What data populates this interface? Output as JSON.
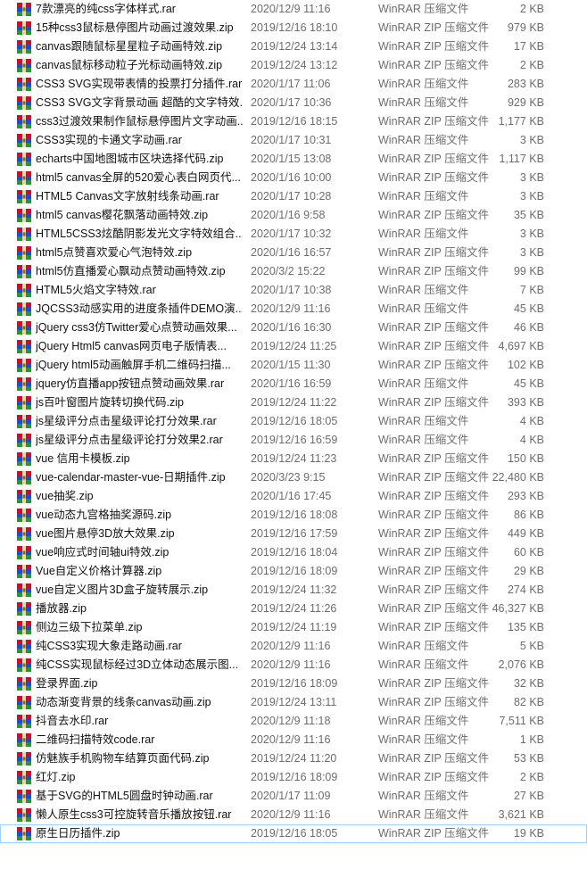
{
  "files": [
    {
      "name": "7款漂亮的纯css字体样式.rar",
      "date": "2020/12/9 11:16",
      "type": "WinRAR 压缩文件",
      "size": "2 KB"
    },
    {
      "name": "15种css3鼠标悬停图片动画过渡效果.zip",
      "date": "2019/12/16 18:10",
      "type": "WinRAR ZIP 压缩文件",
      "size": "979 KB"
    },
    {
      "name": "canvas跟随鼠标星星粒子动画特效.zip",
      "date": "2019/12/24 13:14",
      "type": "WinRAR ZIP 压缩文件",
      "size": "17 KB"
    },
    {
      "name": "canvas鼠标移动粒子光标动画特效.zip",
      "date": "2019/12/24 13:12",
      "type": "WinRAR ZIP 压缩文件",
      "size": "2 KB"
    },
    {
      "name": "CSS3 SVG实现带表情的投票打分插件.rar",
      "date": "2020/1/17 11:06",
      "type": "WinRAR 压缩文件",
      "size": "283 KB"
    },
    {
      "name": "CSS3 SVG文字背景动画 超酷的文字特效...",
      "date": "2020/1/17 10:36",
      "type": "WinRAR 压缩文件",
      "size": "929 KB"
    },
    {
      "name": "css3过渡效果制作鼠标悬停图片文字动画...",
      "date": "2019/12/16 18:15",
      "type": "WinRAR ZIP 压缩文件",
      "size": "1,177 KB"
    },
    {
      "name": "CSS3实现的卡通文字动画.rar",
      "date": "2020/1/17 10:31",
      "type": "WinRAR 压缩文件",
      "size": "3 KB"
    },
    {
      "name": "echarts中国地图城市区块选择代码.zip",
      "date": "2020/1/15 13:08",
      "type": "WinRAR ZIP 压缩文件",
      "size": "1,117 KB"
    },
    {
      "name": "html5 canvas全屏的520爱心表白网页代...",
      "date": "2020/1/16 10:00",
      "type": "WinRAR ZIP 压缩文件",
      "size": "3 KB"
    },
    {
      "name": "HTML5 Canvas文字放射线条动画.rar",
      "date": "2020/1/17 10:28",
      "type": "WinRAR 压缩文件",
      "size": "3 KB"
    },
    {
      "name": "html5 canvas樱花飘落动画特效.zip",
      "date": "2020/1/16 9:58",
      "type": "WinRAR ZIP 压缩文件",
      "size": "35 KB"
    },
    {
      "name": "HTML5CSS3炫酷阴影发光文字特效组合...",
      "date": "2020/1/17 10:32",
      "type": "WinRAR 压缩文件",
      "size": "3 KB"
    },
    {
      "name": "html5点赞喜欢爱心气泡特效.zip",
      "date": "2020/1/16 16:57",
      "type": "WinRAR ZIP 压缩文件",
      "size": "3 KB"
    },
    {
      "name": "html5仿直播爱心飘动点赞动画特效.zip",
      "date": "2020/3/2 15:22",
      "type": "WinRAR ZIP 压缩文件",
      "size": "99 KB"
    },
    {
      "name": "HTML5火焰文字特效.rar",
      "date": "2020/1/17 10:38",
      "type": "WinRAR 压缩文件",
      "size": "7 KB"
    },
    {
      "name": "JQCSS3动感实用的进度条插件DEMO演...",
      "date": "2020/12/9 11:16",
      "type": "WinRAR 压缩文件",
      "size": "45 KB"
    },
    {
      "name": "jQuery css3仿Twitter爱心点赞动画效果...",
      "date": "2020/1/16 16:30",
      "type": "WinRAR ZIP 压缩文件",
      "size": "46 KB"
    },
    {
      "name": "jQuery Html5 canvas网页电子版情表...",
      "date": "2019/12/24 11:25",
      "type": "WinRAR ZIP 压缩文件",
      "size": "4,697 KB"
    },
    {
      "name": "jQuery html5动画触屏手机二维码扫描...",
      "date": "2020/1/15 11:30",
      "type": "WinRAR ZIP 压缩文件",
      "size": "102 KB"
    },
    {
      "name": "jquery仿直播app按钮点赞动画效果.rar",
      "date": "2020/1/16 16:59",
      "type": "WinRAR 压缩文件",
      "size": "45 KB"
    },
    {
      "name": "js百叶窗图片旋转切换代码.zip",
      "date": "2019/12/24 11:22",
      "type": "WinRAR ZIP 压缩文件",
      "size": "393 KB"
    },
    {
      "name": "js星级评分点击星级评论打分效果.rar",
      "date": "2019/12/16 18:05",
      "type": "WinRAR 压缩文件",
      "size": "4 KB"
    },
    {
      "name": "js星级评分点击星级评论打分效果2.rar",
      "date": "2019/12/16 16:59",
      "type": "WinRAR 压缩文件",
      "size": "4 KB"
    },
    {
      "name": "vue 信用卡模板.zip",
      "date": "2019/12/24 11:23",
      "type": "WinRAR ZIP 压缩文件",
      "size": "150 KB"
    },
    {
      "name": "vue-calendar-master-vue-日期插件.zip",
      "date": "2020/3/23 9:15",
      "type": "WinRAR ZIP 压缩文件",
      "size": "22,480 KB"
    },
    {
      "name": "vue抽奖.zip",
      "date": "2020/1/16 17:45",
      "type": "WinRAR ZIP 压缩文件",
      "size": "293 KB"
    },
    {
      "name": "vue动态九宫格抽奖源码.zip",
      "date": "2019/12/16 18:08",
      "type": "WinRAR ZIP 压缩文件",
      "size": "86 KB"
    },
    {
      "name": "vue图片悬停3D放大效果.zip",
      "date": "2019/12/16 17:59",
      "type": "WinRAR ZIP 压缩文件",
      "size": "449 KB"
    },
    {
      "name": "vue响应式时间轴ui特效.zip",
      "date": "2019/12/16 18:04",
      "type": "WinRAR ZIP 压缩文件",
      "size": "60 KB"
    },
    {
      "name": "Vue自定义价格计算器.zip",
      "date": "2019/12/16 18:09",
      "type": "WinRAR ZIP 压缩文件",
      "size": "29 KB"
    },
    {
      "name": "vue自定义图片3D盒子旋转展示.zip",
      "date": "2019/12/24 11:32",
      "type": "WinRAR ZIP 压缩文件",
      "size": "274 KB"
    },
    {
      "name": "播放器.zip",
      "date": "2019/12/24 11:26",
      "type": "WinRAR ZIP 压缩文件",
      "size": "46,327 KB"
    },
    {
      "name": "侧边三级下拉菜单.zip",
      "date": "2019/12/24 11:19",
      "type": "WinRAR ZIP 压缩文件",
      "size": "135 KB"
    },
    {
      "name": "纯CSS3实现大象走路动画.rar",
      "date": "2020/12/9 11:16",
      "type": "WinRAR 压缩文件",
      "size": "5 KB"
    },
    {
      "name": "纯CSS实现鼠标经过3D立体动态展示图...",
      "date": "2020/12/9 11:16",
      "type": "WinRAR 压缩文件",
      "size": "2,076 KB"
    },
    {
      "name": "登录界面.zip",
      "date": "2019/12/16 18:09",
      "type": "WinRAR ZIP 压缩文件",
      "size": "32 KB"
    },
    {
      "name": "动态渐变背景的线条canvas动画.zip",
      "date": "2019/12/24 13:11",
      "type": "WinRAR ZIP 压缩文件",
      "size": "82 KB"
    },
    {
      "name": "抖音去水印.rar",
      "date": "2020/12/9 11:18",
      "type": "WinRAR 压缩文件",
      "size": "7,511 KB"
    },
    {
      "name": "二维码扫描特效code.rar",
      "date": "2020/12/9 11:16",
      "type": "WinRAR 压缩文件",
      "size": "1 KB"
    },
    {
      "name": "仿魅族手机购物车结算页面代码.zip",
      "date": "2019/12/24 11:20",
      "type": "WinRAR ZIP 压缩文件",
      "size": "53 KB"
    },
    {
      "name": "红灯.zip",
      "date": "2019/12/16 18:09",
      "type": "WinRAR ZIP 压缩文件",
      "size": "2 KB"
    },
    {
      "name": "基于SVG的HTML5圆盘时钟动画.rar",
      "date": "2020/1/17 11:09",
      "type": "WinRAR 压缩文件",
      "size": "27 KB"
    },
    {
      "name": "懒人原生css3可控旋转音乐播放按钮.rar",
      "date": "2020/12/9 11:16",
      "type": "WinRAR 压缩文件",
      "size": "3,621 KB"
    },
    {
      "name": "原生日历插件.zip",
      "date": "2019/12/16 18:05",
      "type": "WinRAR ZIP 压缩文件",
      "size": "19 KB"
    }
  ],
  "selected_index": 44,
  "icon": "winrar-archive-icon",
  "colors": {
    "name_text": "#111111",
    "meta_text": "#6d6d6d",
    "selection_border": "#99d1ff",
    "icon_red": "#c8102e",
    "icon_blue": "#1f4fbf",
    "icon_purple": "#6b2f9e",
    "icon_green": "#2f8f3a"
  }
}
